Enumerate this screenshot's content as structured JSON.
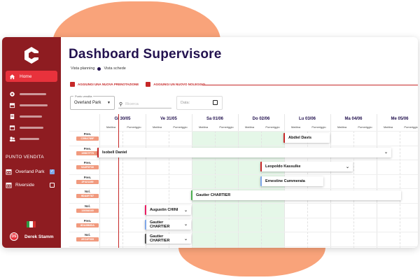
{
  "app": {
    "title": "Dashboard Supervisore",
    "views": {
      "planning": "Vista planning",
      "schede": "Vista schede"
    }
  },
  "sidebar": {
    "home": "Home",
    "punto_vendita_title": "PUNTO VENDITA",
    "stores": [
      {
        "name": "Overland Park",
        "checked": true
      },
      {
        "name": "Riverside",
        "checked": false
      }
    ],
    "user": {
      "initials": "DS",
      "name": "Derek Stamm"
    },
    "accent": "#8e1c21"
  },
  "actions": {
    "add_booking": "AGGIUNGI UNA NUOVA PRENOTAZIONE",
    "add_rental": "AGGIUNGI UN NUOVO NOLEGGIO"
  },
  "filters": {
    "punto_vendita_label": "Punto vendita",
    "punto_vendita_value": "Overland Park",
    "search_placeholder": "Ricerca",
    "date_placeholder": "Data:"
  },
  "calendar": {
    "days": [
      {
        "label": "Gi 30/05",
        "am": "Mattina",
        "pm": "Pomeriggio"
      },
      {
        "label": "Ve 31/05",
        "am": "Mattina",
        "pm": "Pomeriggio"
      },
      {
        "label": "Sa 01/06",
        "am": "Mattina",
        "pm": "Pomeriggio"
      },
      {
        "label": "Do 02/06",
        "am": "Mattina",
        "pm": "Pomeriggio"
      },
      {
        "label": "Lu 03/06",
        "am": "Mattina",
        "pm": "Pomeriggio"
      },
      {
        "label": "Ma 04/06",
        "am": "Mattina",
        "pm": "Pomeriggio"
      },
      {
        "label": "Me 05/06",
        "am": "Mattina",
        "pm": "Pomeriggio"
      }
    ],
    "rows": [
      {
        "type": "Pren.",
        "code": "C5BA789F"
      },
      {
        "type": "Pren.",
        "code": "19B07F79"
      },
      {
        "type": "Pren.",
        "code": "9A6F6F30"
      },
      {
        "type": "Pren.",
        "code": "2F421289"
      },
      {
        "type": "Nol.",
        "code": "9DA8F787"
      },
      {
        "type": "Nol.",
        "code": "1369A049"
      },
      {
        "type": "Pren.",
        "code": "8DA6B8DA"
      },
      {
        "type": "Nol.",
        "code": "2EC4F009"
      }
    ],
    "bookings": [
      {
        "name": "Abdiel Davis",
        "color": "#c62828",
        "expandable": false
      },
      {
        "name": "Isobell Daniel",
        "color": "#c62828",
        "expandable": true
      },
      {
        "name": "Leopoldo Kassulke",
        "color": "#c62828",
        "expandable": true
      },
      {
        "name": "Ernestine Cummerata",
        "color": "#7fa7e8",
        "expandable": false
      },
      {
        "name": "Gautier CHARTIER",
        "color": "#4caf50",
        "expandable": false
      },
      {
        "name": "Augustin CHINI",
        "color": "#e91e63",
        "expandable": true
      },
      {
        "name": "Gautier CHARTIER",
        "color": "#7fa7e8",
        "expandable": true
      },
      {
        "name": "Gautier CHARTIER",
        "color": "#555555",
        "expandable": true
      }
    ]
  }
}
